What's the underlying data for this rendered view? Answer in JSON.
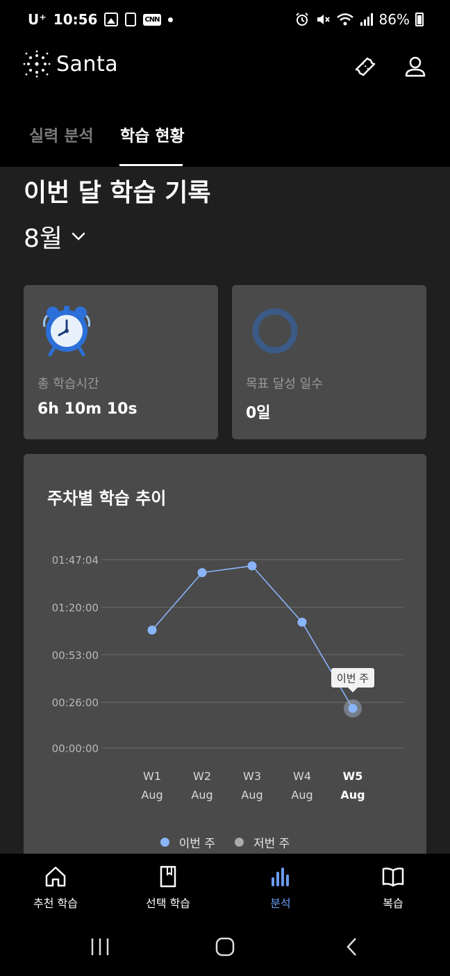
{
  "status_bar": {
    "carrier": "U⁺",
    "time": "10:56",
    "notif_cnn": "CNN",
    "battery": "86%"
  },
  "header": {
    "app_name": "Santa",
    "icons": [
      "ticket-icon",
      "profile-icon"
    ]
  },
  "tabs": [
    {
      "label": "실력 분석",
      "active": false
    },
    {
      "label": "학습 현황",
      "active": true
    }
  ],
  "main": {
    "section_title": "이번 달 학습 기록",
    "month": "8월",
    "cards": [
      {
        "icon": "alarm-clock-icon",
        "label": "총 학습시간",
        "value": "6h 10m 10s"
      },
      {
        "icon": "goal-ring-icon",
        "label": "목표 달성 일수",
        "value": "0일"
      }
    ],
    "chart_title": "주차별 학습 추이",
    "tooltip": "이번 주"
  },
  "chart_data": {
    "type": "line",
    "categories": [
      "W1",
      "W2",
      "W3",
      "W4",
      "W5"
    ],
    "category_sub": [
      "Aug",
      "Aug",
      "Aug",
      "Aug",
      "Aug"
    ],
    "highlighted_category": "W5",
    "y_ticks": [
      "00:00:00",
      "00:26:00",
      "00:53:00",
      "01:20:00",
      "01:47:04"
    ],
    "ylim_seconds": [
      0,
      6424
    ],
    "series": [
      {
        "name": "이번 주",
        "color": "#8ab4f8",
        "values_seconds": [
          4020,
          5980,
          6210,
          4290,
          1350
        ]
      },
      {
        "name": "저번 주",
        "color": "#aaaaaa",
        "values_seconds": []
      }
    ],
    "grid": true,
    "legend_position": "bottom"
  },
  "legend": [
    {
      "label": "이번 주",
      "color": "#8ab4f8"
    },
    {
      "label": "저번 주",
      "color": "#aaaaaa"
    }
  ],
  "bottom_nav": [
    {
      "label": "추천 학습",
      "icon": "home-icon",
      "active": false
    },
    {
      "label": "선택 학습",
      "icon": "book-icon",
      "active": false
    },
    {
      "label": "분석",
      "icon": "bar-chart-icon",
      "active": true
    },
    {
      "label": "복습",
      "icon": "open-book-icon",
      "active": false
    }
  ],
  "colors": {
    "background": "#000000",
    "surface": "#1f1f1f",
    "card": "#4a4a4a",
    "accent": "#6b9cf4"
  }
}
